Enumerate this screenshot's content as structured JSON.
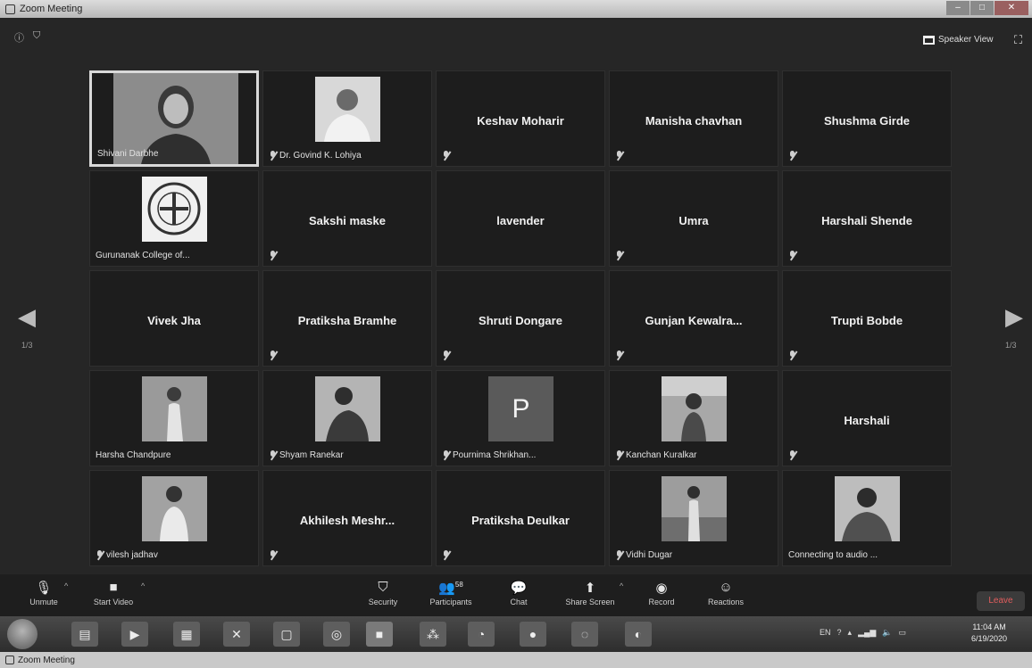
{
  "window": {
    "title": "Zoom Meeting",
    "controls": [
      "–",
      "□",
      "✕"
    ]
  },
  "header": {
    "info_icon": "info-icon",
    "shield_icon": "shield-icon",
    "speaker_view_label": "Speaker View",
    "fullscreen_icon": "fullscreen-icon"
  },
  "pagination": {
    "left_page": "1/3",
    "right_page": "1/3"
  },
  "participants": [
    {
      "name": "Shivani Darbhe",
      "video": true,
      "active": true
    },
    {
      "name": "Dr. Govind K. Lohiya",
      "video": true,
      "muted": true
    },
    {
      "name": "Keshav Moharir",
      "muted": true
    },
    {
      "name": "Manisha chavhan",
      "muted": true
    },
    {
      "name": "Shushma Girde",
      "muted": true
    },
    {
      "name": "Gurunanak College of...",
      "video": true,
      "logo": true
    },
    {
      "name": "Sakshi maske",
      "muted": true
    },
    {
      "name": "lavender"
    },
    {
      "name": "Umra",
      "muted": true
    },
    {
      "name": "Harshali Shende",
      "muted": true
    },
    {
      "name": "Vivek Jha"
    },
    {
      "name": "Pratiksha Bramhe",
      "muted": true
    },
    {
      "name": "Shruti Dongare",
      "muted": true
    },
    {
      "name": "Gunjan Kewalra...",
      "muted": true
    },
    {
      "name": "Trupti Bobde",
      "muted": true
    },
    {
      "name": "Harsha Chandpure",
      "video": true
    },
    {
      "name": "Shyam Ranekar",
      "video": true,
      "muted": true
    },
    {
      "name": "Pournima Shrikhan...",
      "avatar_letter": "P",
      "muted": true
    },
    {
      "name": "Kanchan Kuralkar",
      "video": true,
      "muted": true
    },
    {
      "name": "Harshali",
      "muted": true
    },
    {
      "name": "vilesh jadhav",
      "video": true,
      "muted": true
    },
    {
      "name": "Akhilesh Meshr...",
      "muted": true
    },
    {
      "name": "Pratiksha Deulkar",
      "muted": true
    },
    {
      "name": "Vidhi Dugar",
      "video": true,
      "muted": true
    },
    {
      "name": "Connecting to audio ...",
      "video": true
    }
  ],
  "toolbar": {
    "unmute": "Unmute",
    "start_video": "Start Video",
    "security": "Security",
    "participants": "Participants",
    "participants_count": "58",
    "chat": "Chat",
    "share_screen": "Share Screen",
    "record": "Record",
    "reactions": "Reactions",
    "leave": "Leave"
  },
  "taskbar": {
    "language": "EN",
    "time": "11:04 AM",
    "date": "6/19/2020"
  },
  "status_bar": {
    "title": "Zoom Meeting"
  }
}
